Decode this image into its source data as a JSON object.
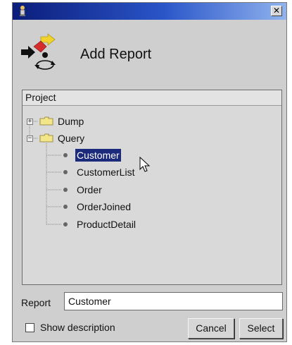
{
  "window": {
    "title": "Add Report",
    "close_glyph": "✕",
    "app_icon": "app-icon",
    "header_icon": "add-report-icon"
  },
  "tree": {
    "column_header": "Project",
    "items": [
      {
        "label": "Dump",
        "type": "folder",
        "expanded": false
      },
      {
        "label": "Query",
        "type": "folder",
        "expanded": true,
        "children": [
          {
            "label": "Customer",
            "selected": true
          },
          {
            "label": "CustomerList",
            "selected": false
          },
          {
            "label": "Order",
            "selected": false
          },
          {
            "label": "OrderJoined",
            "selected": false
          },
          {
            "label": "ProductDetail",
            "selected": false
          }
        ]
      }
    ]
  },
  "report": {
    "label": "Report",
    "value": "Customer"
  },
  "show_description": {
    "label": "Show description",
    "checked": false
  },
  "buttons": {
    "cancel": "Cancel",
    "select": "Select"
  },
  "colors": {
    "title_bar_dark": "#0b1d7a",
    "title_bar_light": "#8fb3ee",
    "selection": "#1b2a7a",
    "dialog_bg": "#cfcfcf"
  }
}
